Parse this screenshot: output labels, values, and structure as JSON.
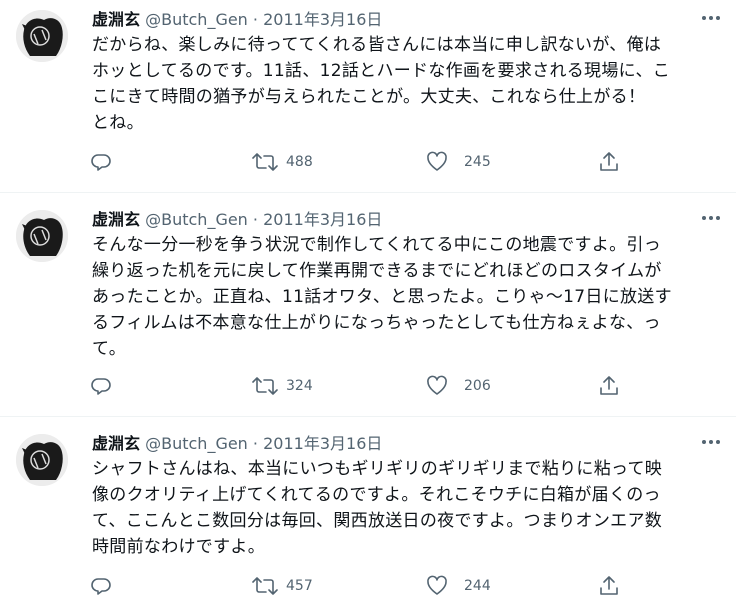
{
  "tweets": [
    {
      "name": "虚淵玄",
      "handle": "@Butch_Gen",
      "separator": "·",
      "date": "2011年3月16日",
      "text": "だからね、楽しみに待っててくれる皆さんには本当に申し訳ないが、俺は\nホッとしてるのです。11話、12話とハードな作画を要求される現場に、こ\nこにきて時間の猶予が与えられたことが。大丈夫、これなら仕上がる！\nとね。",
      "retweets": "488",
      "likes": "245"
    },
    {
      "name": "虚淵玄",
      "handle": "@Butch_Gen",
      "separator": "·",
      "date": "2011年3月16日",
      "text": "そんな一分一秒を争う状況で制作してくれてる中にこの地震ですよ。引っ\n繰り返った机を元に戻して作業再開できるまでにどれほどのロスタイムが\nあったことか。正直ね、11話オワタ、と思ったよ。こりゃ〜17日に放送す\nるフィルムは不本意な仕上がりになっちゃったとしても仕方ねぇよな、っ\nて。",
      "retweets": "324",
      "likes": "206"
    },
    {
      "name": "虚淵玄",
      "handle": "@Butch_Gen",
      "separator": "·",
      "date": "2011年3月16日",
      "text": "シャフトさんはね、本当にいつもギリギリのギリギリまで粘りに粘って映\n像のクオリティ上げてくれてるのですよ。それこそウチに白箱が届くのっ\nて、ここんとこ数回分は毎回、関西放送日の夜ですよ。つまりオンエア数\n時間前なわけですよ。",
      "retweets": "457",
      "likes": "244"
    }
  ],
  "icons": {
    "more": "more-icon",
    "reply": "reply-icon",
    "retweet": "retweet-icon",
    "like": "heart-icon",
    "share": "share-icon"
  },
  "colors": {
    "text": "#0f1419",
    "secondary": "#536471",
    "divider": "#eff3f4"
  }
}
